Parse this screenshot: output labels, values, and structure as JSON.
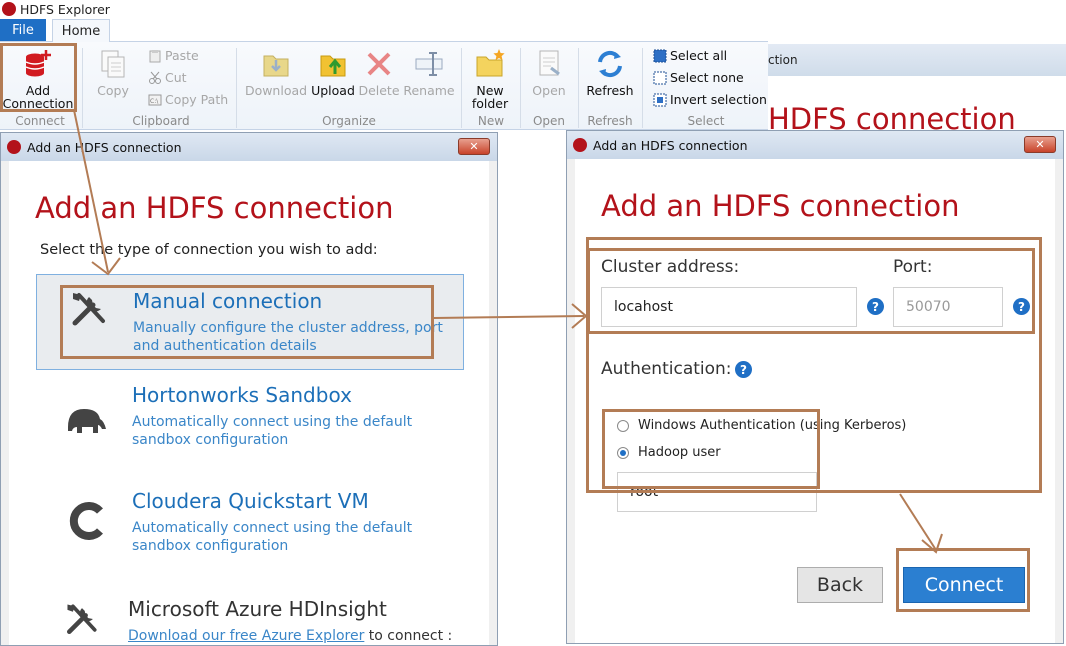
{
  "app": {
    "title": "HDFS Explorer",
    "tabs": {
      "file": "File",
      "home": "Home"
    }
  },
  "ribbon": {
    "connect": {
      "add_line1": "Add",
      "add_line2": "Connection",
      "group": "Connect"
    },
    "clipboard": {
      "copy": "Copy",
      "paste": "Paste",
      "cut": "Cut",
      "copy_path": "Copy Path",
      "group": "Clipboard"
    },
    "organize": {
      "download": "Download",
      "upload": "Upload",
      "delete": "Delete",
      "rename": "Rename",
      "group": "Organize"
    },
    "new": {
      "line1": "New",
      "line2": "folder",
      "group": "New"
    },
    "open": {
      "label": "Open",
      "group": "Open"
    },
    "refresh": {
      "label": "Refresh",
      "group": "Refresh"
    },
    "select": {
      "all": "Select all",
      "none": "Select none",
      "invert": "Invert selection",
      "group": "Select"
    }
  },
  "background_window": {
    "title_fragment": "ction",
    "heading_fragment": "HDFS connection"
  },
  "dialog1": {
    "title": "Add an HDFS connection",
    "heading": "Add an HDFS connection",
    "prompt": "Select the type of connection you wish to add:",
    "options": [
      {
        "title": "Manual connection",
        "desc1": "Manually configure the cluster address, port",
        "desc2": "and authentication details"
      },
      {
        "title": "Hortonworks Sandbox",
        "desc1": "Automatically connect using the default",
        "desc2": "sandbox configuration"
      },
      {
        "title": "Cloudera Quickstart VM",
        "desc1": "Automatically connect using the default",
        "desc2": "sandbox configuration"
      },
      {
        "title": "Microsoft Azure HDInsight",
        "desc1": "Download our free Azure Explorer",
        "desc1b": "to connect :"
      }
    ]
  },
  "dialog2": {
    "title": "Add an HDFS connection",
    "heading": "Add an HDFS connection",
    "cluster_label": "Cluster address:",
    "cluster_value": "locahost",
    "port_label": "Port:",
    "port_placeholder": "50070",
    "auth_label": "Authentication:",
    "auth_windows": "Windows Authentication (using Kerberos)",
    "auth_hadoop": "Hadoop user",
    "hadoop_user_value": "root",
    "back": "Back",
    "connect": "Connect"
  },
  "colors": {
    "accent_red": "#b3121a",
    "link_blue": "#1c6fb8",
    "primary_button": "#2b7fd1",
    "highlight": "#b37c55"
  },
  "help_glyph": "?",
  "close_glyph": "✕"
}
